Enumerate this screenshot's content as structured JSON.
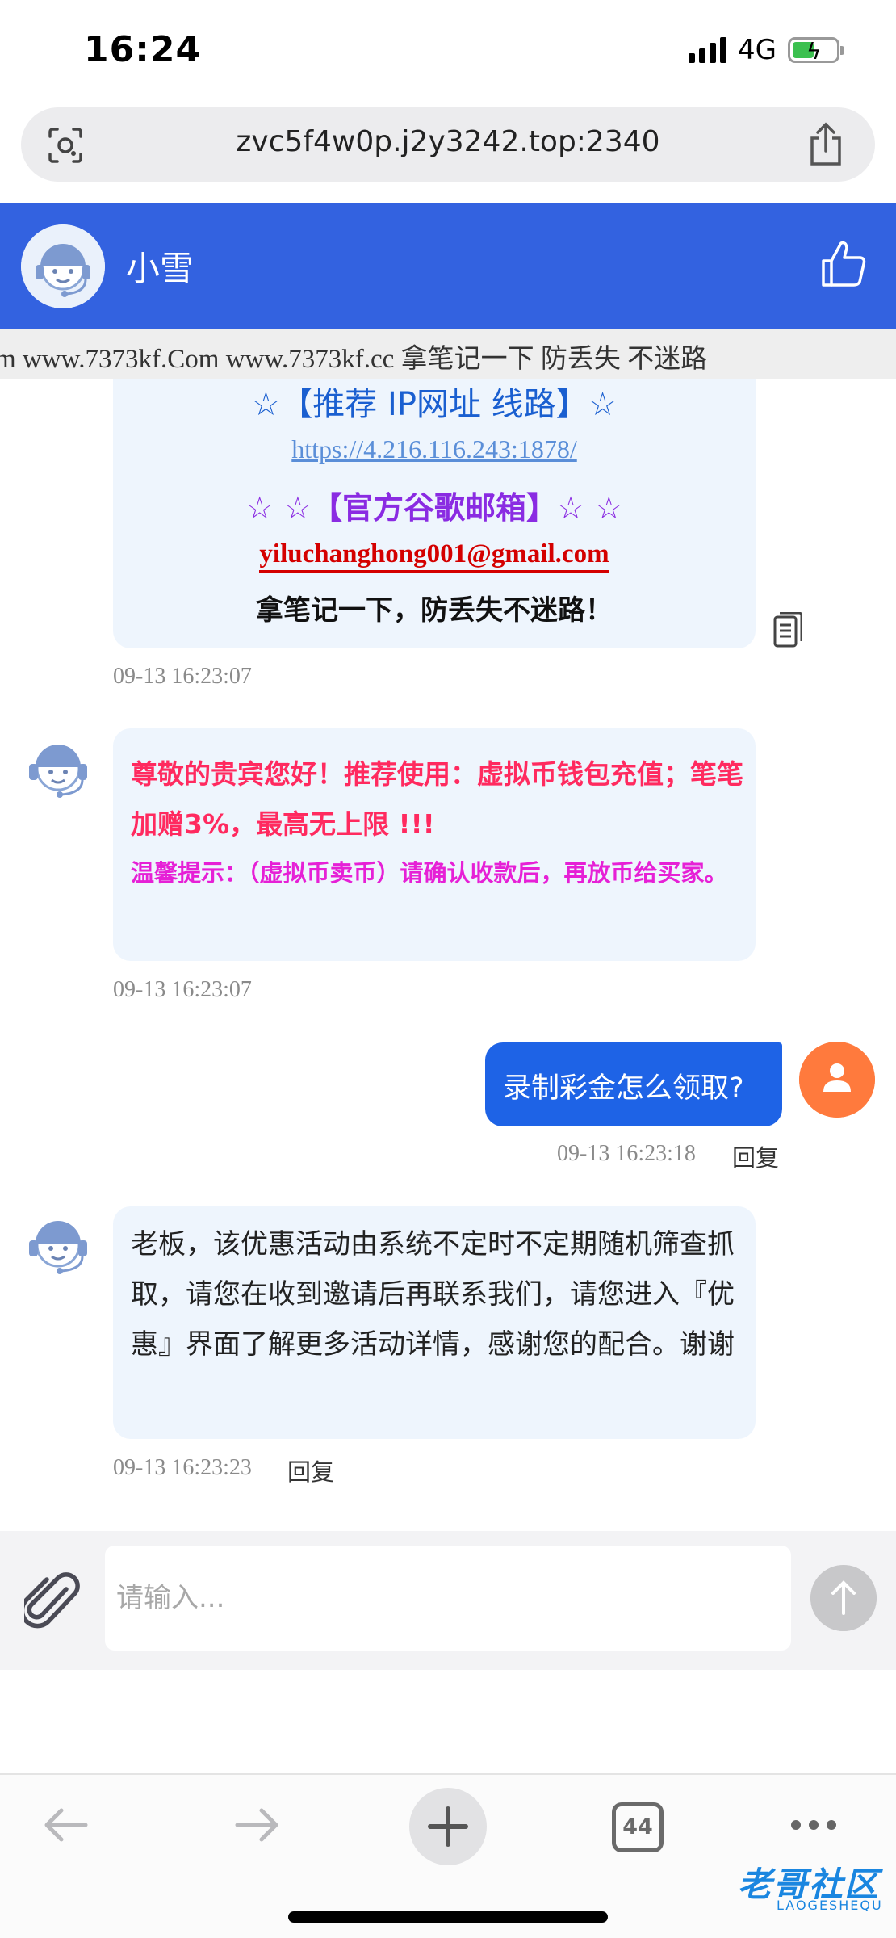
{
  "status_bar": {
    "time": "16:24",
    "network": "4G"
  },
  "browser": {
    "url": "zvc5f4w0p.j2y3242.top:2340",
    "tab_count": "44"
  },
  "header": {
    "agent_name": "小雪"
  },
  "marquee": {
    "text": "m www.7373kf.Com www.7373kf.cc 拿笔记一下 防丢失 不迷路"
  },
  "messages": {
    "info": {
      "line1": "☆【推荐 IP网址 线路】☆",
      "line2": "https://4.216.116.243:1878/",
      "line3": "☆ ☆【官方谷歌邮箱】☆ ☆",
      "line4": "yiluchanghong001@gmail.com",
      "line5": "拿笔记一下，防丢失不迷路！",
      "time": "09-13 16:23:07"
    },
    "promo": {
      "text1": "尊敬的贵宾您好！推荐使用：虚拟币钱包充值；笔笔加赠3%，最高无上限 !!!",
      "text2": "温馨提示：（虚拟币卖币）请确认收款后，再放币给买家。",
      "time": "09-13 16:23:07"
    },
    "user": {
      "text": "录制彩金怎么领取?",
      "time": "09-13 16:23:18",
      "reply_label": "回复"
    },
    "agent_reply": {
      "text": "老板，该优惠活动由系统不定时不定期随机筛查抓取，请您在收到邀请后再联系我们，请您进入『优惠』界面了解更多活动详情，感谢您的配合。谢谢",
      "time": "09-13 16:23:23",
      "reply_label": "回复"
    }
  },
  "composer": {
    "placeholder": "请输入..."
  },
  "watermark": {
    "text": "老哥社区",
    "sub": "LAOGESHEQU"
  },
  "colors": {
    "header_bg": "#3362e0",
    "user_bubble": "#1e63e6",
    "agent_bubble": "#eef5fd",
    "promo_red": "#ff2a5f",
    "promo_magenta": "#e620d6",
    "user_avatar": "#ff7a3d"
  },
  "icons": [
    "lens-icon",
    "share-icon",
    "like-icon",
    "copy-icon",
    "paperclip-icon",
    "send-arrow-icon",
    "back-arrow-icon",
    "forward-arrow-icon",
    "plus-icon",
    "more-icon"
  ]
}
